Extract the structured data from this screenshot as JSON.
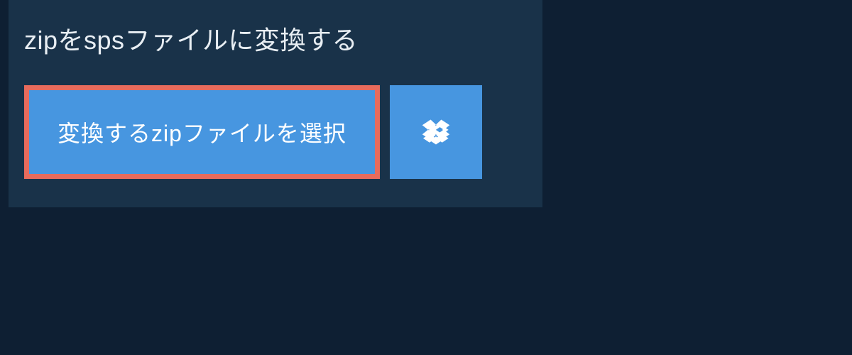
{
  "header": {
    "title": "zipをspsファイルに変換する"
  },
  "buttons": {
    "select_label": "変換するzipファイルを選択"
  }
}
